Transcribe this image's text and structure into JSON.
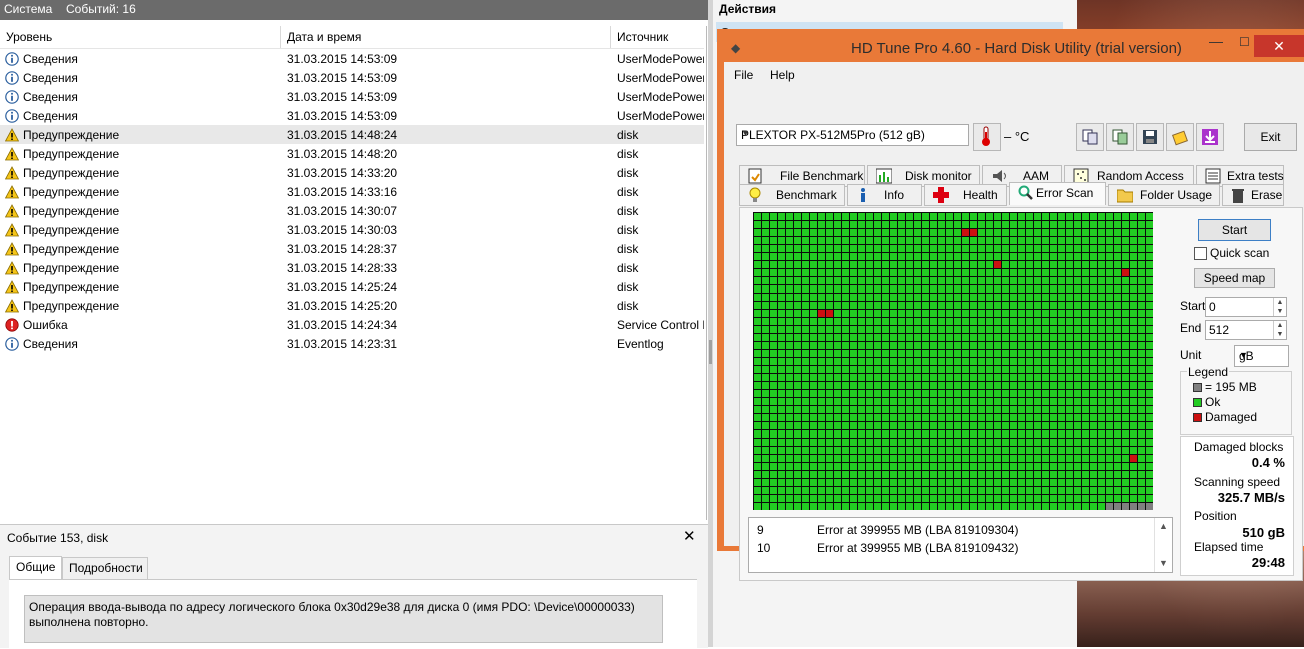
{
  "eventviewer": {
    "header_title": "Система",
    "header_count": "Событий: 16",
    "columns": [
      "Уровень",
      "Дата и время",
      "Источник"
    ],
    "rows": [
      {
        "level": "Сведения",
        "date": "31.03.2015 14:53:09",
        "source": "UserModePower",
        "type": "info"
      },
      {
        "level": "Сведения",
        "date": "31.03.2015 14:53:09",
        "source": "UserModePower",
        "type": "info"
      },
      {
        "level": "Сведения",
        "date": "31.03.2015 14:53:09",
        "source": "UserModePower",
        "type": "info"
      },
      {
        "level": "Сведения",
        "date": "31.03.2015 14:53:09",
        "source": "UserModePower",
        "type": "info"
      },
      {
        "level": "Предупреждение",
        "date": "31.03.2015 14:48:24",
        "source": "disk",
        "type": "warning",
        "selected": true
      },
      {
        "level": "Предупреждение",
        "date": "31.03.2015 14:48:20",
        "source": "disk",
        "type": "warning"
      },
      {
        "level": "Предупреждение",
        "date": "31.03.2015 14:33:20",
        "source": "disk",
        "type": "warning"
      },
      {
        "level": "Предупреждение",
        "date": "31.03.2015 14:33:16",
        "source": "disk",
        "type": "warning"
      },
      {
        "level": "Предупреждение",
        "date": "31.03.2015 14:30:07",
        "source": "disk",
        "type": "warning"
      },
      {
        "level": "Предупреждение",
        "date": "31.03.2015 14:30:03",
        "source": "disk",
        "type": "warning"
      },
      {
        "level": "Предупреждение",
        "date": "31.03.2015 14:28:37",
        "source": "disk",
        "type": "warning"
      },
      {
        "level": "Предупреждение",
        "date": "31.03.2015 14:28:33",
        "source": "disk",
        "type": "warning"
      },
      {
        "level": "Предупреждение",
        "date": "31.03.2015 14:25:24",
        "source": "disk",
        "type": "warning"
      },
      {
        "level": "Предупреждение",
        "date": "31.03.2015 14:25:20",
        "source": "disk",
        "type": "warning"
      },
      {
        "level": "Ошибка",
        "date": "31.03.2015 14:24:34",
        "source": "Service Control M",
        "type": "error"
      },
      {
        "level": "Сведения",
        "date": "31.03.2015 14:23:31",
        "source": "Eventlog",
        "type": "info"
      }
    ],
    "details": {
      "title": "Событие 153, disk",
      "close_glyph": "✕",
      "tabs": [
        "Общие",
        "Подробности"
      ],
      "message_line1": "Операция ввода-вывода по адресу логического блока 0x30d29e38 для диска 0 (имя PDO: \\Device\\00000033)",
      "message_line2": "выполнена повторно."
    }
  },
  "actions": {
    "title": "Действия",
    "item": "Система"
  },
  "hdtune": {
    "title": "HD Tune Pro 4.60 - Hard Disk Utility (trial version)",
    "menu": [
      "File",
      "Help"
    ],
    "drive": "PLEXTOR PX-512M5Pro (512 gB)",
    "temperature": "– °C",
    "exit_label": "Exit",
    "tabs_row1": [
      "File Benchmark",
      "Disk monitor",
      "AAM",
      "Random Access",
      "Extra tests"
    ],
    "tabs_row2": [
      "Benchmark",
      "Info",
      "Health",
      "Error Scan",
      "Folder Usage",
      "Erase"
    ],
    "active_tab": "Error Scan",
    "start_label": "Start",
    "quick_scan_label": "Quick scan",
    "quick_scan_checked": false,
    "speed_map_label": "Speed map",
    "start_field_label": "Start",
    "start_value": "0",
    "end_field_label": "End",
    "end_value": "512",
    "unit_label": "Unit",
    "unit_value": "gB",
    "legend": {
      "title": "Legend",
      "block_size": "= 195 MB",
      "ok": "Ok",
      "damaged": "Damaged",
      "colors": {
        "block": "#808080",
        "ok": "#22cc22",
        "damaged": "#cc1111"
      }
    },
    "stats": {
      "damaged_label": "Damaged blocks",
      "damaged_value": "0.4 %",
      "speed_label": "Scanning speed",
      "speed_value": "325.7 MB/s",
      "position_label": "Position",
      "position_value": "510 gB",
      "elapsed_label": "Elapsed time",
      "elapsed_value": "29:48"
    },
    "log": [
      {
        "n": "9",
        "text": "Error at 399955 MB (LBA 819109304)"
      },
      {
        "n": "10",
        "text": "Error at 399955 MB (LBA 819109432)"
      }
    ],
    "scan_map": {
      "cols": 50,
      "rows": 37,
      "damaged_cells": [
        [
          26,
          2
        ],
        [
          27,
          2
        ],
        [
          30,
          6
        ],
        [
          46,
          7
        ],
        [
          8,
          12
        ],
        [
          9,
          12
        ],
        [
          47,
          30
        ]
      ],
      "unscanned_last_row_from_col": 44
    }
  }
}
